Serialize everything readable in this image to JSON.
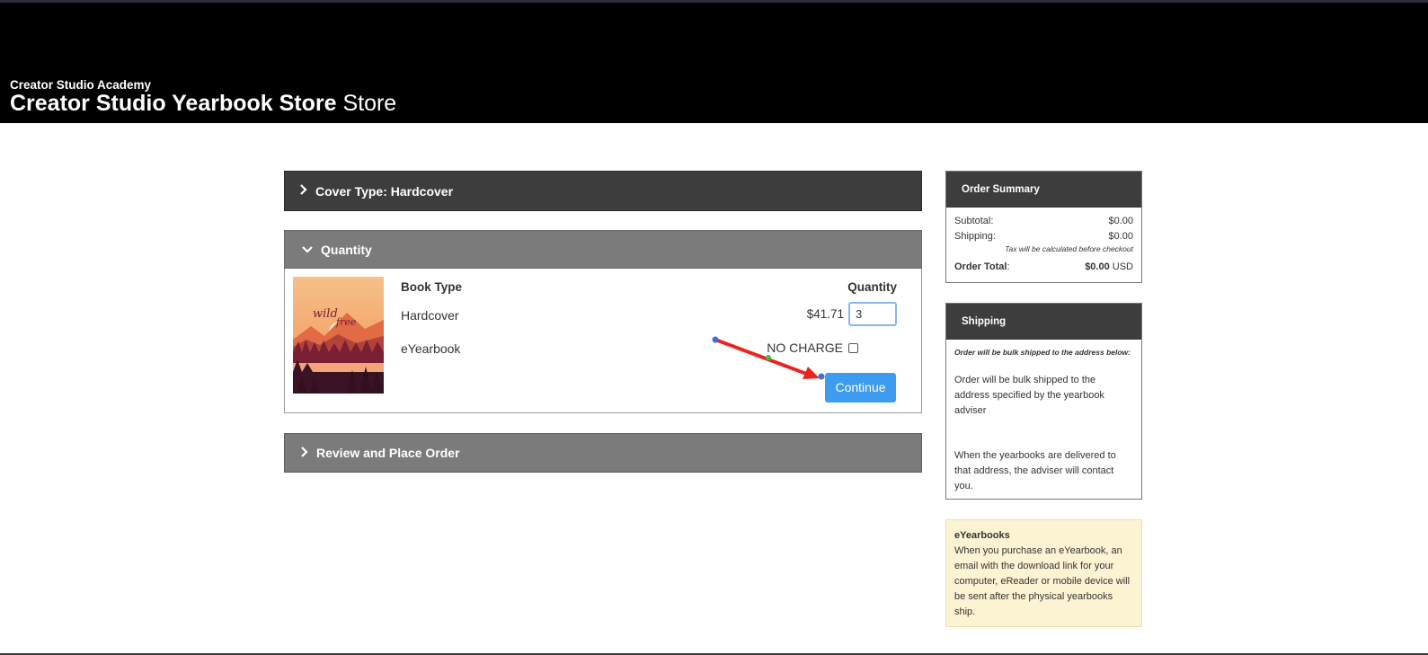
{
  "header": {
    "school": "Creator Studio Academy",
    "title_bold": "Creator Studio Yearbook Store",
    "title_suffix": " Store"
  },
  "panels": {
    "cover": {
      "icon": "chevron-right-icon",
      "label": "Cover Type: Hardcover"
    },
    "quantity": {
      "icon": "chevron-down-icon",
      "label": "Quantity"
    },
    "review": {
      "icon": "chevron-right-icon",
      "label": "Review and Place Order"
    }
  },
  "quantity": {
    "col_book": "Book Type",
    "col_qty": "Quantity",
    "hardcover": {
      "label": "Hardcover",
      "price": "$41.71",
      "qty": "3"
    },
    "eyearbook": {
      "label": "eYearbook",
      "price": "NO CHARGE",
      "checked": false
    },
    "continue": "Continue",
    "cover_text_1": "wild",
    "cover_text_2": "free"
  },
  "summary": {
    "title": "Order Summary",
    "subtotal_label": "Subtotal:",
    "subtotal": "$0.00",
    "shipping_label": "Shipping:",
    "shipping": "$0.00",
    "tax_note": "Tax will be calculated before checkout",
    "total_label": "Order Total",
    "total_colon": ":",
    "total": "$0.00",
    "currency": " USD"
  },
  "shipping": {
    "title": "Shipping",
    "note": "Order will be bulk shipped to the address below:",
    "p1": "Order will be bulk shipped to the address specified by the yearbook adviser",
    "p2": "When the yearbooks are delivered to that address, the adviser will contact you."
  },
  "eyearbooks": {
    "title": "eYearbooks",
    "text": "When you purchase an eYearbook, an email with the download link for your computer, eReader or mobile device will be sent after the physical yearbooks ship."
  },
  "colors": {
    "header_bg": "#000000",
    "panel_dark": "#3d3d3d",
    "panel_gray": "#7b7b7b",
    "accent": "#3d9cf0",
    "annotation_arrow": "#e8261f",
    "info_bg": "#fcf3d2"
  }
}
